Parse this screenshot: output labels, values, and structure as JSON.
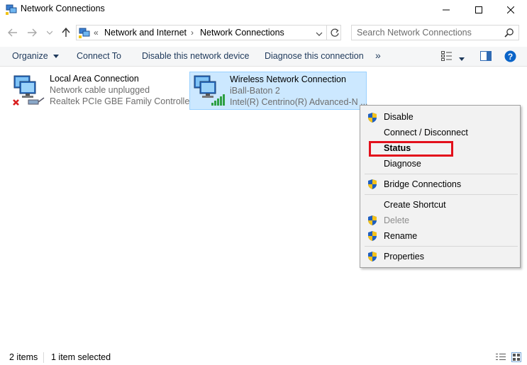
{
  "window": {
    "title": "Network Connections",
    "controls": [
      "minimize",
      "maximize",
      "close"
    ]
  },
  "address": {
    "overflow": "«",
    "crumbs": [
      "Network and Internet",
      "Network Connections"
    ],
    "separator": "›"
  },
  "search": {
    "placeholder": "Search Network Connections"
  },
  "toolbar": {
    "organize": "Organize",
    "connect_to": "Connect To",
    "disable_device": "Disable this network device",
    "diagnose": "Diagnose this connection",
    "more": "»"
  },
  "items": [
    {
      "name": "Local Area Connection",
      "status": "Network cable unplugged",
      "adapter": "Realtek PCIe GBE Family Controller",
      "selected": false
    },
    {
      "name": "Wireless Network Connection",
      "status": "iBall-Baton  2",
      "adapter": "Intel(R) Centrino(R) Advanced-N ...",
      "selected": true
    }
  ],
  "context_menu": {
    "items": [
      {
        "label": "Disable",
        "shield": true,
        "disabled": false,
        "bold": false
      },
      {
        "label": "Connect / Disconnect",
        "shield": false,
        "disabled": false,
        "bold": false
      },
      {
        "label": "Status",
        "shield": false,
        "disabled": false,
        "bold": true
      },
      {
        "label": "Diagnose",
        "shield": false,
        "disabled": false,
        "bold": false
      },
      {
        "label": "Bridge Connections",
        "shield": true,
        "disabled": false,
        "bold": false
      },
      {
        "label": "Create Shortcut",
        "shield": false,
        "disabled": false,
        "bold": false
      },
      {
        "label": "Delete",
        "shield": true,
        "disabled": true,
        "bold": false
      },
      {
        "label": "Rename",
        "shield": true,
        "disabled": false,
        "bold": false
      },
      {
        "label": "Properties",
        "shield": true,
        "disabled": false,
        "bold": false
      }
    ],
    "highlight_color": "#e3101c"
  },
  "statusbar": {
    "item_count": "2 items",
    "selection": "1 item selected"
  },
  "colors": {
    "selection_bg": "#cce8ff",
    "toolbar_text": "#1e395b",
    "help_blue": "#0a64c8"
  }
}
